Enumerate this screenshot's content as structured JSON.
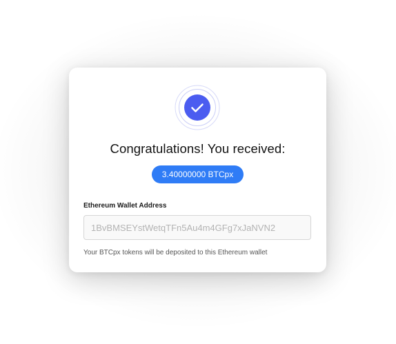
{
  "dialog": {
    "headline": "Congratulations! You received:",
    "amount": "3.40000000 BTCpx",
    "wallet_field": {
      "label": "Ethereum Wallet Address",
      "value": "1BvBMSEYstWetqTFn5Au4m4GFg7xJaNVN2"
    },
    "helper_text": "Your BTCpx tokens will be deposited to this Ethereum wallet",
    "success_icon": "checkmark-icon"
  },
  "colors": {
    "accent": "#4b5cf0",
    "pill": "#2f7cf6",
    "ring": "#c9cdf7"
  }
}
